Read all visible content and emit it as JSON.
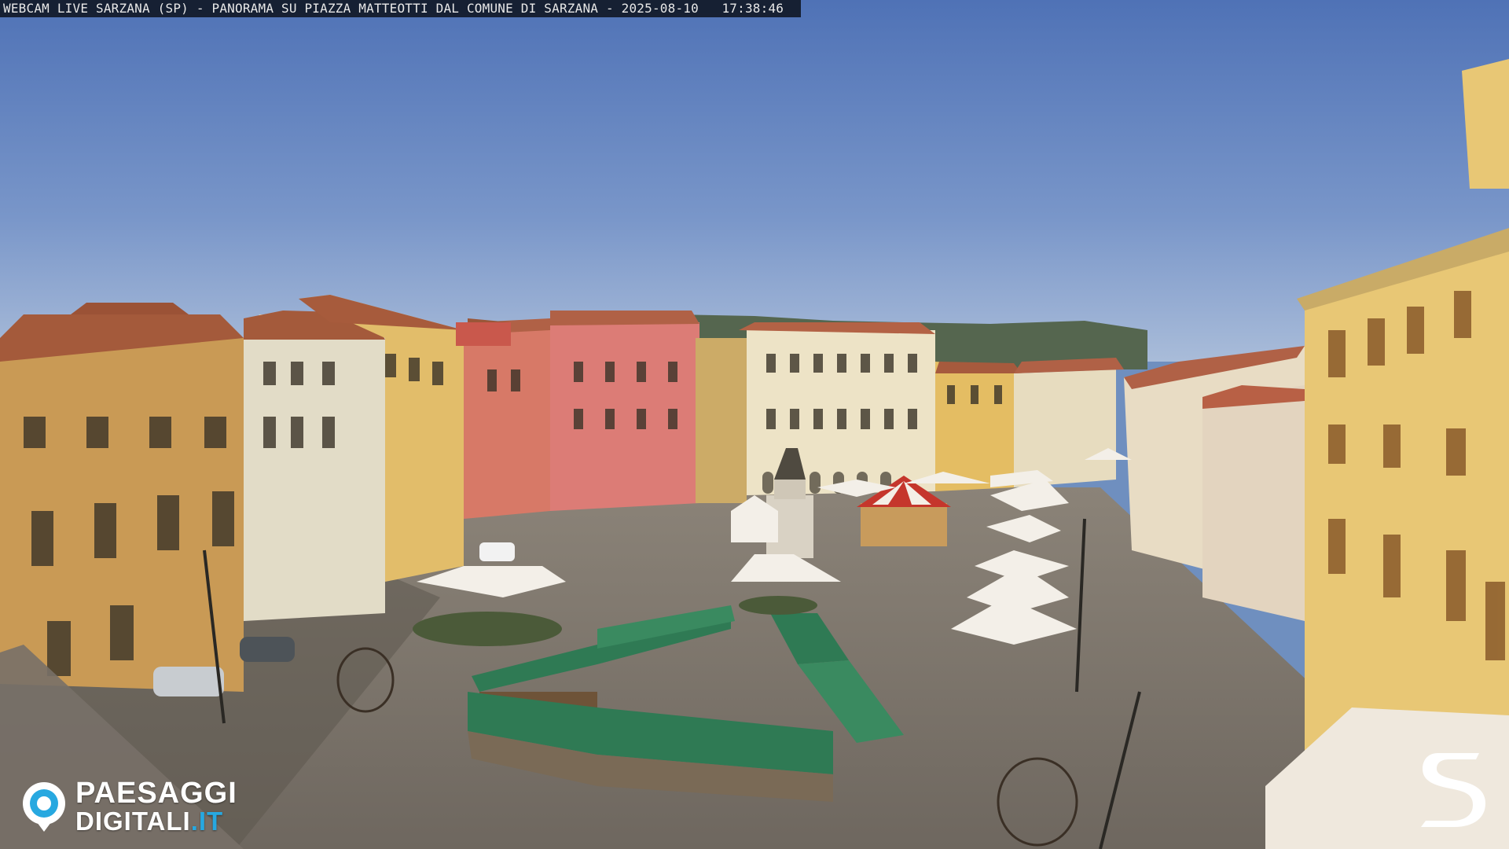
{
  "webcam": {
    "caption": "WEBCAM LIVE SARZANA (SP) - PANORAMA SU PIAZZA MATTEOTTI DAL COMUNE DI SARZANA - 2025-08-10   17:38:46"
  },
  "branding": {
    "logo_line1": "PAESAGGI",
    "logo_line2": "DIGITALI",
    "logo_suffix": ".IT",
    "logo_icon": "eye-camera-icon",
    "corner_logo": "s-letter-logo",
    "accent_color": "#27a8e0"
  }
}
